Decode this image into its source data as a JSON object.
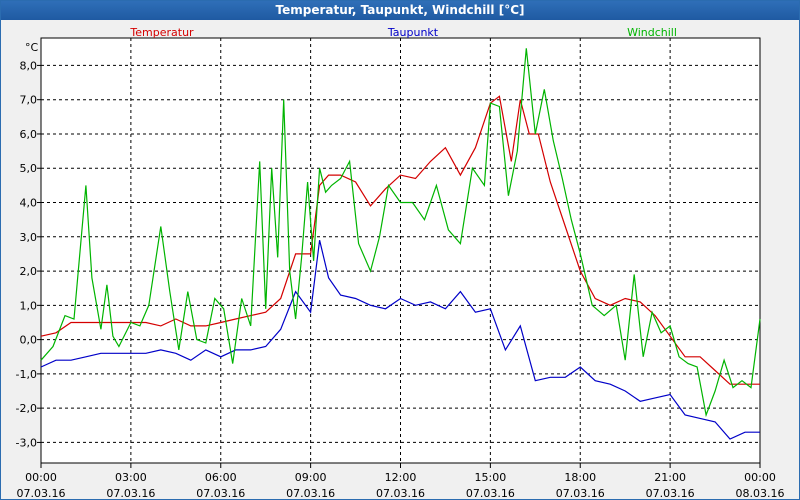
{
  "window": {
    "title": "Temperatur, Taupunkt, Windchill [°C]"
  },
  "chart_data": {
    "type": "line",
    "title": "Temperatur, Taupunkt, Windchill [°C]",
    "ylabel": "°C",
    "ylim": [
      -3.6,
      8.8
    ],
    "xlim": [
      0,
      24
    ],
    "grid": true,
    "legend": "top",
    "y_ticks": [
      8.0,
      7.0,
      6.0,
      5.0,
      4.0,
      3.0,
      2.0,
      1.0,
      0.0,
      -1.0,
      -2.0,
      -3.0
    ],
    "y_tick_labels": [
      "8,0",
      "7,0",
      "6,0",
      "5,0",
      "4,0",
      "3,0",
      "2,0",
      "1,0",
      "0,0",
      "-1,0",
      "-2,0",
      "-3,0"
    ],
    "x_ticks": [
      {
        "hour": 0,
        "time": "00:00",
        "date": "07.03.16"
      },
      {
        "hour": 3,
        "time": "03:00",
        "date": "07.03.16"
      },
      {
        "hour": 6,
        "time": "06:00",
        "date": "07.03.16"
      },
      {
        "hour": 9,
        "time": "09:00",
        "date": "07.03.16"
      },
      {
        "hour": 12,
        "time": "12:00",
        "date": "07.03.16"
      },
      {
        "hour": 15,
        "time": "15:00",
        "date": "07.03.16"
      },
      {
        "hour": 18,
        "time": "18:00",
        "date": "07.03.16"
      },
      {
        "hour": 21,
        "time": "21:00",
        "date": "07.03.16"
      },
      {
        "hour": 24,
        "time": "00:00",
        "date": "08.03.16"
      }
    ],
    "series": [
      {
        "name": "Temperatur",
        "color": "#d40000",
        "x": [
          0,
          0.5,
          1,
          2,
          3,
          3.5,
          4,
          4.5,
          5,
          5.5,
          6,
          6.5,
          7,
          7.5,
          8,
          8.5,
          9,
          9.3,
          9.6,
          10,
          10.5,
          11,
          11.5,
          12,
          12.5,
          13,
          13.5,
          14,
          14.5,
          15,
          15.3,
          15.7,
          16,
          16.3,
          16.6,
          17,
          17.5,
          18,
          18.5,
          19,
          19.5,
          20,
          20.5,
          21,
          21.5,
          22,
          22.5,
          23,
          23.5,
          24
        ],
        "values": [
          0.1,
          0.2,
          0.5,
          0.5,
          0.5,
          0.5,
          0.4,
          0.6,
          0.4,
          0.4,
          0.5,
          0.6,
          0.7,
          0.8,
          1.2,
          2.5,
          2.5,
          4.5,
          4.8,
          4.8,
          4.6,
          3.9,
          4.4,
          4.8,
          4.7,
          5.2,
          5.6,
          4.8,
          5.6,
          6.9,
          7.1,
          5.2,
          7.0,
          6.0,
          6.0,
          4.6,
          3.3,
          2.0,
          1.2,
          1.0,
          1.2,
          1.1,
          0.7,
          0.1,
          -0.5,
          -0.5,
          -0.9,
          -1.3,
          -1.3,
          -1.3
        ]
      },
      {
        "name": "Taupunkt",
        "color": "#0000c8",
        "x": [
          0,
          0.5,
          1,
          1.5,
          2,
          2.5,
          3,
          3.5,
          4,
          4.5,
          5,
          5.5,
          6,
          6.5,
          7,
          7.5,
          8,
          8.5,
          9,
          9.3,
          9.6,
          10,
          10.5,
          11,
          11.5,
          12,
          12.5,
          13,
          13.5,
          14,
          14.5,
          15,
          15.5,
          16,
          16.5,
          17,
          17.5,
          18,
          18.5,
          19,
          19.5,
          20,
          20.5,
          21,
          21.5,
          22,
          22.5,
          23,
          23.5,
          24
        ],
        "values": [
          -0.8,
          -0.6,
          -0.6,
          -0.5,
          -0.4,
          -0.4,
          -0.4,
          -0.4,
          -0.3,
          -0.4,
          -0.6,
          -0.3,
          -0.5,
          -0.3,
          -0.3,
          -0.2,
          0.3,
          1.4,
          0.8,
          2.9,
          1.8,
          1.3,
          1.2,
          1.0,
          0.9,
          1.2,
          1.0,
          1.1,
          0.9,
          1.4,
          0.8,
          0.9,
          -0.3,
          0.4,
          -1.2,
          -1.1,
          -1.1,
          -0.8,
          -1.2,
          -1.3,
          -1.5,
          -1.8,
          -1.7,
          -1.6,
          -2.2,
          -2.3,
          -2.4,
          -2.9,
          -2.7,
          -2.7
        ]
      },
      {
        "name": "Windchill",
        "color": "#00b400",
        "x": [
          0,
          0.4,
          0.8,
          1.1,
          1.5,
          1.7,
          2.0,
          2.2,
          2.4,
          2.6,
          3.0,
          3.3,
          3.6,
          4.0,
          4.3,
          4.6,
          4.9,
          5.2,
          5.5,
          5.8,
          6.1,
          6.4,
          6.7,
          7.0,
          7.3,
          7.5,
          7.7,
          7.9,
          8.1,
          8.3,
          8.5,
          8.7,
          8.9,
          9.1,
          9.3,
          9.5,
          9.7,
          10,
          10.3,
          10.6,
          11,
          11.3,
          11.6,
          12,
          12.4,
          12.8,
          13.2,
          13.6,
          14,
          14.4,
          14.8,
          15,
          15.3,
          15.6,
          15.9,
          16.2,
          16.5,
          16.8,
          17.1,
          17.4,
          17.7,
          18,
          18.4,
          18.8,
          19.2,
          19.5,
          19.8,
          20.1,
          20.4,
          20.7,
          21,
          21.3,
          21.6,
          21.9,
          22.2,
          22.5,
          22.8,
          23.1,
          23.4,
          23.7,
          24
        ],
        "values": [
          -0.6,
          -0.2,
          0.7,
          0.6,
          4.5,
          1.8,
          0.3,
          1.6,
          0.1,
          -0.2,
          0.5,
          0.4,
          1.0,
          3.3,
          1.4,
          -0.3,
          1.4,
          0.0,
          -0.1,
          1.2,
          0.9,
          -0.7,
          1.2,
          0.4,
          5.2,
          0.9,
          5.0,
          2.4,
          7.0,
          2.0,
          0.6,
          2.4,
          4.6,
          2.3,
          5.0,
          4.3,
          4.5,
          4.7,
          5.2,
          2.8,
          2.0,
          3.0,
          4.5,
          4.0,
          4.0,
          3.5,
          4.5,
          3.2,
          2.8,
          5.0,
          4.5,
          6.9,
          6.8,
          4.2,
          5.5,
          8.5,
          6.0,
          7.3,
          5.8,
          4.7,
          3.5,
          2.5,
          1.0,
          0.7,
          1.0,
          -0.6,
          1.9,
          -0.5,
          0.8,
          0.2,
          0.4,
          -0.5,
          -0.7,
          -0.8,
          -2.2,
          -1.5,
          -0.6,
          -1.4,
          -1.2,
          -1.4,
          0.6
        ]
      }
    ]
  }
}
